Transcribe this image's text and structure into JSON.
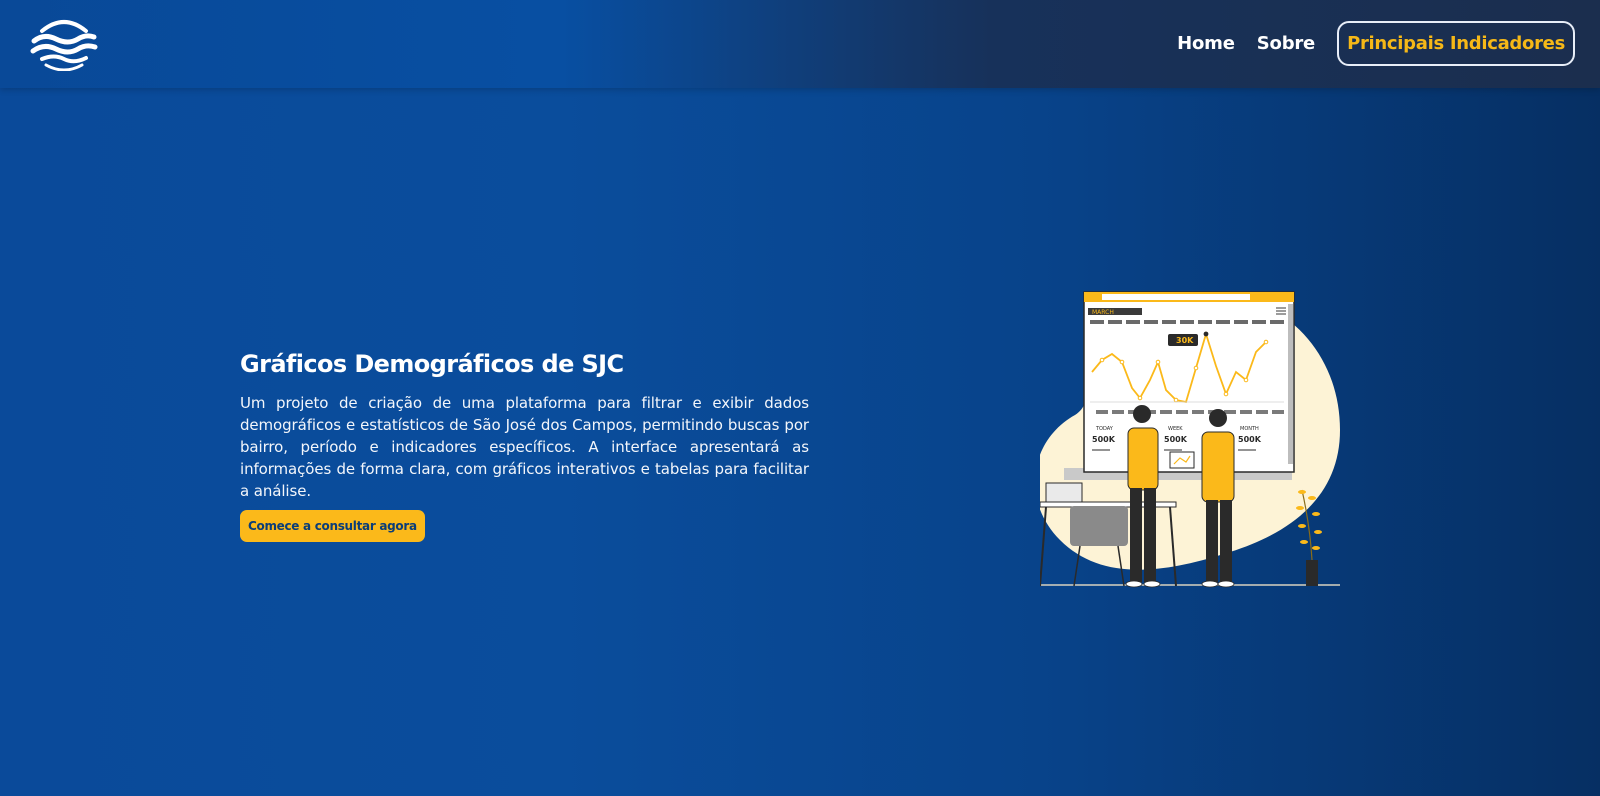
{
  "nav": {
    "logo_icon": "waves-logo-icon",
    "links": [
      {
        "label": "Home"
      },
      {
        "label": "Sobre"
      }
    ],
    "cta_label": "Principais Indicadores"
  },
  "hero": {
    "title": "Gráficos Demográficos de SJC",
    "description": "Um projeto de criação de uma plataforma para filtrar e exibir dados demográficos e estatísticos de São José dos Campos, permitindo buscas por bairro, período e indicadores específicos. A interface apresentará as informações de forma clara, com gráficos interativos e tabelas para facilitar a análise.",
    "button_label": "Comece a consultar agora"
  },
  "illustration": {
    "subject": "people-analyzing-dashboard-illustration",
    "month_label": "MARCH",
    "peak_label": "30K",
    "stats": [
      {
        "period": "TODAY",
        "value": "500K"
      },
      {
        "period": "WEEK",
        "value": "500K"
      },
      {
        "period": "MONTH",
        "value": "500K"
      }
    ]
  },
  "colors": {
    "accent": "#fbb91a",
    "navy": "#0a4a9a",
    "illustration_bg": "#fdf3d6",
    "figure_dark": "#2a2a2a"
  }
}
